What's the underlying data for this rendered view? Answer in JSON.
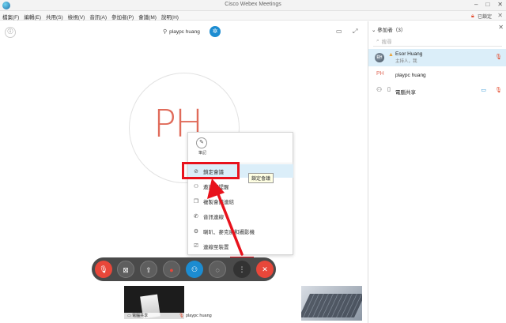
{
  "window": {
    "title": "Cisco Webex Meetings"
  },
  "menubar": {
    "items": [
      "檔案(F)",
      "編輯(E)",
      "共用(S)",
      "檢視(V)",
      "音訊(A)",
      "參加者(P)",
      "會議(M)",
      "說明(H)"
    ],
    "status": "已鎖定"
  },
  "stage": {
    "active_speaker": "playpc huang",
    "avatar_initials": "PH"
  },
  "more_menu": {
    "note_label": "筆記",
    "items": [
      {
        "label": "鎖定會議",
        "icon": "lock-icon"
      },
      {
        "label": "邀請和提醒",
        "icon": "invite-icon"
      },
      {
        "label": "複製會議連結",
        "icon": "copy-icon"
      },
      {
        "label": "音訊連線",
        "icon": "phone-icon"
      },
      {
        "label": "喇叭、麥克風和攝影機",
        "icon": "gear-icon"
      },
      {
        "label": "連線至裝置",
        "icon": "cast-icon"
      }
    ],
    "tooltip": "鎖定會議"
  },
  "thumbnails": {
    "self_label": "電腦共享",
    "name": "playpc huang"
  },
  "participants": {
    "header": "參加者（3）",
    "search_placeholder": "搜尋",
    "list": [
      {
        "name": "Esor Huang",
        "role": "主持人，我",
        "initials": "EH"
      },
      {
        "name": "playpc huang",
        "initials": "PH"
      },
      {
        "name": "電腦共享"
      }
    ]
  },
  "colors": {
    "accent_blue": "#1c8cd1",
    "end_red": "#e8473a",
    "annotation_red": "#e8121c",
    "initials_red": "#e06b5a"
  }
}
